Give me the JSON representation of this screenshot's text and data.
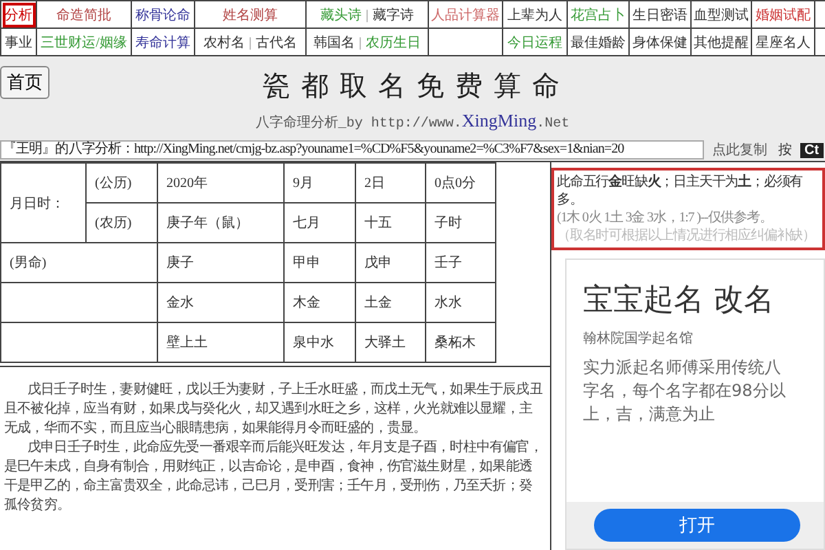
{
  "nav": {
    "rows": [
      [
        {
          "selected": true,
          "links": [
            {
              "label": "分析",
              "color": "#cc0000"
            }
          ]
        },
        {
          "selected": false,
          "links": [
            {
              "label": "命造简批",
              "color": "#b04040"
            }
          ]
        },
        {
          "selected": false,
          "links": [
            {
              "label": "称骨论命",
              "color": "#333399"
            }
          ]
        },
        {
          "selected": false,
          "links": [
            {
              "label": "姓名测算",
              "color": "#b04040"
            }
          ]
        },
        {
          "selected": false,
          "links": [
            {
              "label": "藏头诗",
              "color": "#339933"
            },
            {
              "label": "藏字诗",
              "color": "#333333"
            }
          ]
        },
        {
          "selected": false,
          "links": [
            {
              "label": "人品计算器",
              "color": "#cc6666"
            }
          ]
        },
        {
          "selected": false,
          "links": [
            {
              "label": "上辈为人",
              "color": "#333333"
            }
          ]
        },
        {
          "selected": false,
          "links": [
            {
              "label": "花宫占卜",
              "color": "#339933"
            }
          ]
        },
        {
          "selected": false,
          "links": [
            {
              "label": "生日密语",
              "color": "#333333"
            }
          ]
        },
        {
          "selected": false,
          "links": [
            {
              "label": "血型测试",
              "color": "#333333"
            }
          ]
        },
        {
          "selected": false,
          "links": [
            {
              "label": "婚姻试配",
              "color": "#cc3333"
            }
          ]
        },
        {
          "selected": false
        }
      ],
      [
        {
          "selected": false,
          "links": [
            {
              "label": "事业",
              "color": "#333333"
            }
          ]
        },
        {
          "selected": false,
          "links": [
            {
              "label": "三世财运/姻缘",
              "color": "#339933"
            }
          ]
        },
        {
          "selected": false,
          "links": [
            {
              "label": "寿命计算",
              "color": "#333399"
            }
          ]
        },
        {
          "selected": false,
          "links": [
            {
              "label": "农村名",
              "color": "#333333"
            },
            {
              "label": "古代名",
              "color": "#333333"
            }
          ]
        },
        {
          "selected": false,
          "links": [
            {
              "label": "韩国名",
              "color": "#333333"
            },
            {
              "label": "农历生日",
              "color": "#339933"
            }
          ]
        },
        {
          "selected": false
        },
        {
          "selected": false,
          "links": [
            {
              "label": "今日运程",
              "color": "#339933"
            }
          ]
        },
        {
          "selected": false,
          "links": [
            {
              "label": "最佳婚龄",
              "color": "#333333"
            }
          ]
        },
        {
          "selected": false,
          "links": [
            {
              "label": "身体保健",
              "color": "#333333"
            }
          ]
        },
        {
          "selected": false,
          "links": [
            {
              "label": "其他提醒",
              "color": "#333333"
            }
          ]
        },
        {
          "selected": false,
          "links": [
            {
              "label": "星座名人",
              "color": "#333333"
            }
          ]
        },
        {
          "selected": false
        }
      ]
    ],
    "separator": "|"
  },
  "header": {
    "home_button": "首页",
    "title": "瓷都取名免费算命",
    "subtitle_prefix": "八字命理分析_by http://www.",
    "subtitle_brand": "XingMing",
    "subtitle_suffix": ".Net"
  },
  "share": {
    "url": "『王明』的八字分析：http://XingMing.net/cmjg-bz.asp?youname1=%CD%F5&youname2=%C3%F7&sex=1&nian=20",
    "copy_link": "点此复制",
    "hint": "按",
    "key": "Ct"
  },
  "bazi_table": {
    "rows": [
      {
        "label": "月日时：",
        "calendar": "(公历)",
        "cells": [
          "2020年",
          "9月",
          "2日",
          "0点0分"
        ]
      },
      {
        "label": "",
        "calendar": "(农历)",
        "cells": [
          "庚子年（鼠）",
          "七月",
          "十五",
          "子时"
        ]
      },
      {
        "label": "(男命)",
        "calendar": "",
        "cells": [
          "庚子",
          "甲申",
          "戊申",
          "壬子"
        ]
      },
      {
        "label": "",
        "calendar": "",
        "cells": [
          "金水",
          "木金",
          "土金",
          "水水"
        ]
      },
      {
        "label": "",
        "calendar": "",
        "cells": [
          "壁上土",
          "泉中水",
          "大驿土",
          "桑柘木"
        ]
      }
    ]
  },
  "analysis": {
    "lines": [
      {
        "indent": true,
        "text": "戊日壬子时生，妻财健旺，戊以壬为妻财，子上壬水旺盛，而戊土无气，如果生于辰戌丑"
      },
      {
        "indent": false,
        "text": "且不被化掉，应当有财，如果戊与癸化火，却又遇到水旺之乡，这样，火光就难以显耀，主"
      },
      {
        "indent": false,
        "text": "无成，华而不实，而且应当心眼睛患病，如果能得月令而旺盛的，贵显。"
      },
      {
        "indent": true,
        "text": "戊申日壬子时生，此命应先受一番艰辛而后能兴旺发达，年月支是子酉，时柱中有偏官，"
      },
      {
        "indent": false,
        "text": "是巳午未戌，自身有制合，用财纯正，以吉命论，是申酉，食神，伤官滋生财星，如果能透"
      },
      {
        "indent": false,
        "text": "干是甲乙的，命主富贵双全，此命忌讳，己巳月，受刑害；壬午月，受刑伤，乃至夭折；癸"
      },
      {
        "indent": false,
        "text": "孤伶贫穷。"
      }
    ]
  },
  "wuxing": {
    "summary": "此命五行**金**旺缺**火**；日主天干为**土**；必须有",
    "summary_end": "多。",
    "counts": "(1木 0火 1土 3金 3水，1:7 )--仅供参考。",
    "note": "（取名时可根据以上情况进行相应纠偏补缺）"
  },
  "ad": {
    "title": "宝宝起名 改名",
    "source": "翰林院国学起名馆",
    "body": "实力派起名师傅采用传统八字名，每个名字都在98分以上，吉，满意为止",
    "button": "打开"
  }
}
